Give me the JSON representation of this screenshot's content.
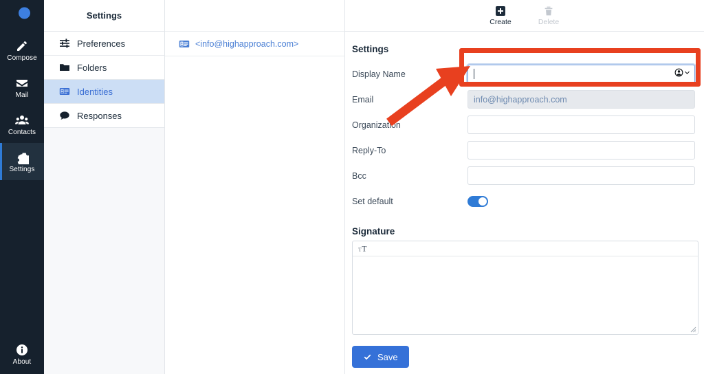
{
  "app": {
    "rail": {
      "logo_icon": "moon-logo-icon",
      "items": [
        {
          "label": "Compose",
          "icon": "compose-icon",
          "active": false
        },
        {
          "label": "Mail",
          "icon": "envelope-icon",
          "active": false
        },
        {
          "label": "Contacts",
          "icon": "contacts-icon",
          "active": false
        },
        {
          "label": "Settings",
          "icon": "gear-icon",
          "active": true
        }
      ],
      "bottom": {
        "label": "About",
        "icon": "info-icon"
      }
    }
  },
  "settings_menu": {
    "header": "Settings",
    "items": [
      {
        "label": "Preferences",
        "icon": "sliders-icon",
        "selected": false
      },
      {
        "label": "Folders",
        "icon": "folder-icon",
        "selected": false
      },
      {
        "label": "Identities",
        "icon": "identity-card-icon",
        "selected": true
      },
      {
        "label": "Responses",
        "icon": "speech-bubble-icon",
        "selected": false
      }
    ]
  },
  "identities_list": {
    "items": [
      {
        "label": "<info@highapproach.com>",
        "icon": "identity-card-icon"
      }
    ]
  },
  "toolbar": {
    "create_label": "Create",
    "create_icon": "plus-square-icon",
    "delete_label": "Delete",
    "delete_icon": "trash-icon",
    "delete_disabled": true
  },
  "form": {
    "title": "Settings",
    "fields": [
      {
        "label": "Display Name",
        "value": "",
        "placeholder": "",
        "readonly": false,
        "focused": true,
        "type": "text"
      },
      {
        "label": "Email",
        "value": "info@highapproach.com",
        "placeholder": "",
        "readonly": true,
        "focused": false,
        "type": "text"
      },
      {
        "label": "Organization",
        "value": "",
        "placeholder": "",
        "readonly": false,
        "focused": false,
        "type": "text"
      },
      {
        "label": "Reply-To",
        "value": "",
        "placeholder": "",
        "readonly": false,
        "focused": false,
        "type": "text"
      },
      {
        "label": "Bcc",
        "value": "",
        "placeholder": "",
        "readonly": false,
        "focused": false,
        "type": "text"
      },
      {
        "label": "Set default",
        "value": "on",
        "type": "toggle"
      }
    ],
    "signature": {
      "title": "Signature",
      "editor_toggle_icon": "text-format-toggle-icon",
      "value": "",
      "placeholder": ""
    },
    "save_label": "Save",
    "save_icon": "check-icon"
  },
  "annotation": {
    "highlight_color": "#e8401f",
    "arrow_color": "#e8401f",
    "target": "Display Name"
  },
  "colors": {
    "rail_bg": "#16212d",
    "rail_active_bg": "#22313f",
    "accent_blue": "#3571d8",
    "link_blue": "#4a7fd4",
    "selected_menu_bg": "#ccdef5",
    "annotation_red": "#e8401f"
  }
}
